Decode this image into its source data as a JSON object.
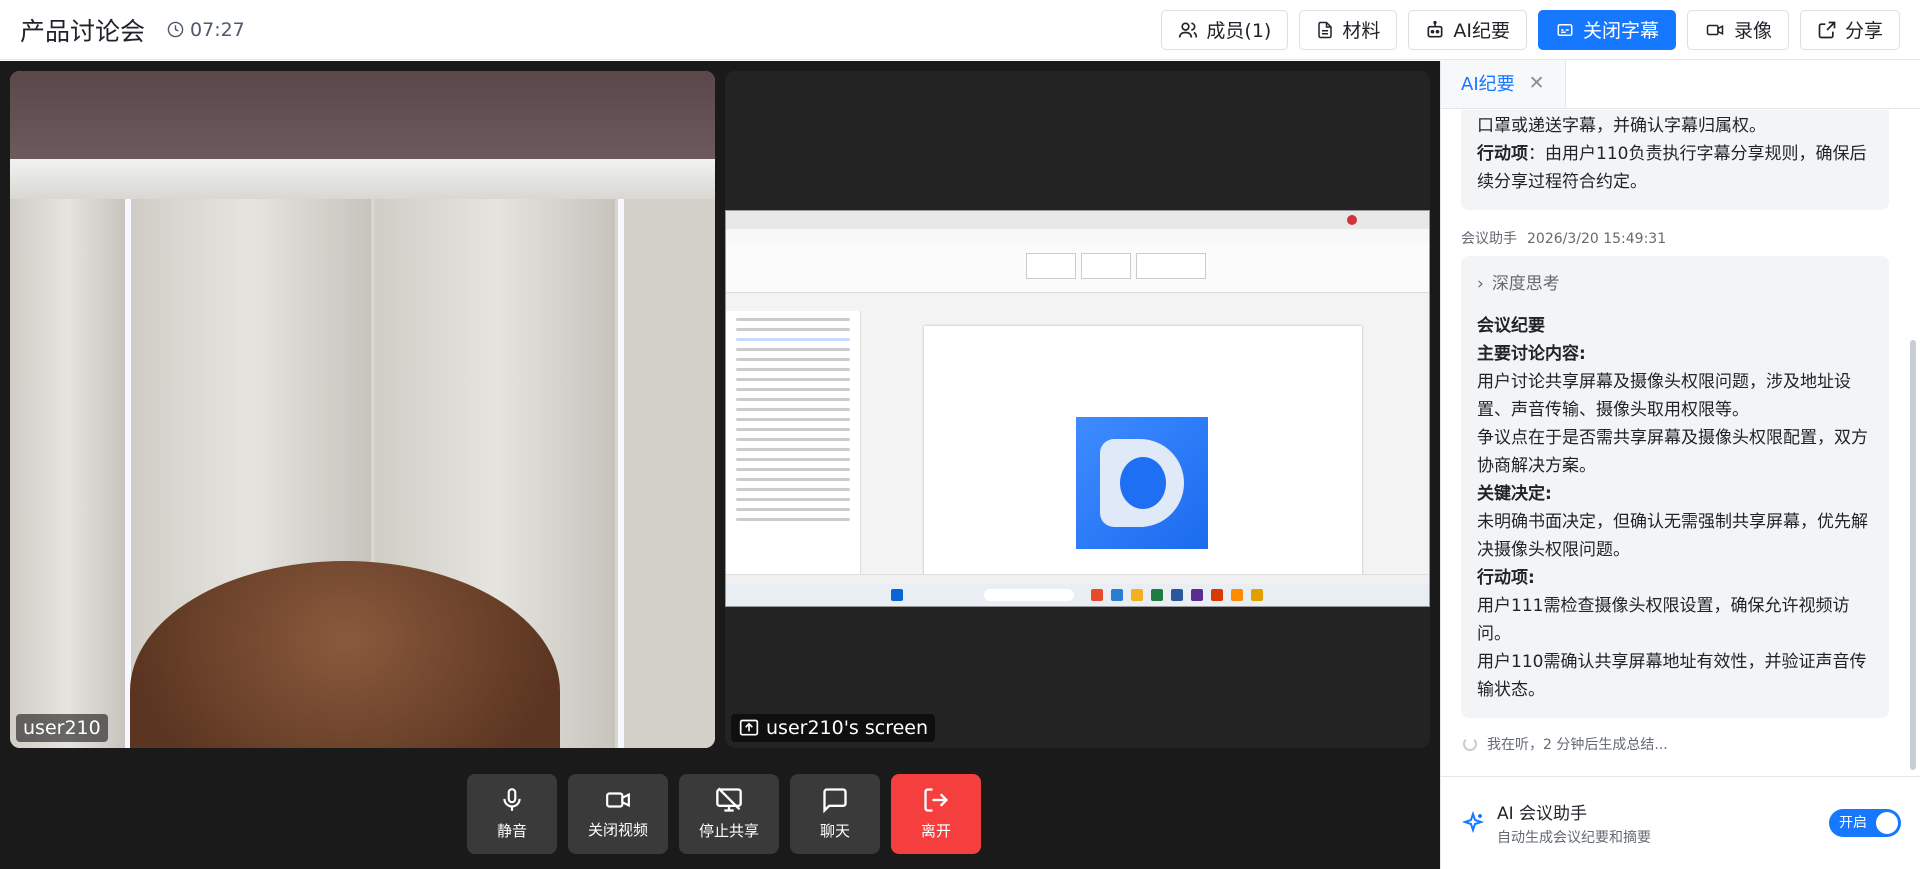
{
  "meeting": {
    "title": "产品讨论会",
    "duration": "07:27"
  },
  "toolbar": {
    "members_label": "成员(1)",
    "materials_label": "材料",
    "ai_summary_label": "AI纪要",
    "captions_label": "关闭字幕",
    "record_label": "录像",
    "share_label": "分享"
  },
  "video": {
    "camera_user": "user210",
    "screen_label": "user210's screen"
  },
  "controls": {
    "mute": "静音",
    "video_off": "关闭视频",
    "stop_share": "停止共享",
    "chat": "聊天",
    "leave": "离开"
  },
  "panel": {
    "tab_label": "AI纪要",
    "first_message": {
      "line1": "口罩或递送字幕，并确认字幕归属权。",
      "action_label": "行动项",
      "action_text": "：由用户110负责执行字幕分享规则，确保后续分享过程符合约定。"
    },
    "second_message": {
      "sender": "会议助手",
      "timestamp": "2026/3/20 15:49:31",
      "deep_thinking": "深度思考",
      "heading": "会议纪要",
      "topics_label": "主要讨论内容",
      "topic_1": "用户讨论共享屏幕及摄像头权限问题，涉及地址设置、声音传输、摄像头取用权限等。",
      "topic_2": "争议点在于是否需共享屏幕及摄像头权限配置，双方协商解决方案。",
      "decision_label": "关键决定",
      "decision_text": "未明确书面决定，但确认无需强制共享屏幕，优先解决摄像头权限问题。",
      "action_label": "行动项",
      "action_1": "用户111需检查摄像头权限设置，确保允许视频访问。",
      "action_2": "用户110需确认共享屏幕地址有效性，并验证声音传输状态。"
    },
    "listening_text": "我在听，2 分钟后生成总结..."
  },
  "assistant": {
    "title": "AI 会议助手",
    "subtitle": "自动生成会议纪要和摘要",
    "toggle_label": "开启"
  },
  "colors": {
    "accent": "#1677ff",
    "danger": "#f53f3f",
    "stage_bg": "#1a1a1a"
  }
}
